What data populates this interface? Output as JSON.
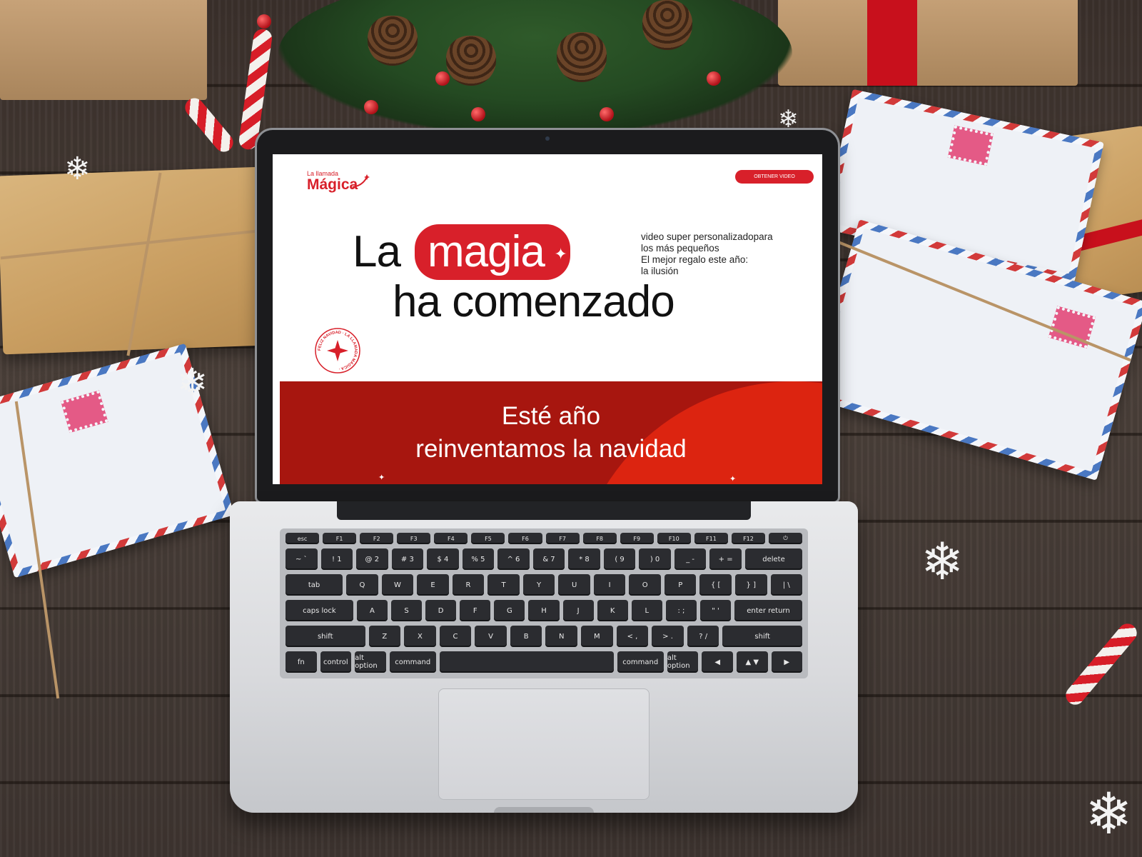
{
  "site": {
    "logo": {
      "small": "La llamada",
      "big": "Mágica"
    },
    "cta_label": "OBTENER VIDEO",
    "hero": {
      "word_1": "La",
      "highlight": "magia",
      "line_2": "ha comenzado",
      "side_lines": [
        "video super personalizadopara",
        "los más pequeños",
        "El mejor regalo este año:",
        "la ilusión"
      ],
      "badge_text": "FELIZ NAVIDAD · LA LLAMADA MÁGICA ·"
    },
    "band": {
      "line_1": "Esté año",
      "line_2": "reinventamos la navidad"
    }
  },
  "keyboard": {
    "fn_row": [
      "esc",
      "F1",
      "F2",
      "F3",
      "F4",
      "F5",
      "F6",
      "F7",
      "F8",
      "F9",
      "F10",
      "F11",
      "F12",
      "⏻"
    ],
    "row_1": [
      "~ `",
      "! 1",
      "@ 2",
      "# 3",
      "$ 4",
      "% 5",
      "^ 6",
      "& 7",
      "* 8",
      "( 9",
      ") 0",
      "_ -",
      "+ =",
      "delete"
    ],
    "row_2": [
      "tab",
      "Q",
      "W",
      "E",
      "R",
      "T",
      "Y",
      "U",
      "I",
      "O",
      "P",
      "{ [",
      "} ]",
      "| \\"
    ],
    "row_3": [
      "caps lock",
      "A",
      "S",
      "D",
      "F",
      "G",
      "H",
      "J",
      "K",
      "L",
      ": ;",
      "\" '",
      "enter return"
    ],
    "row_4": [
      "shift",
      "Z",
      "X",
      "C",
      "V",
      "B",
      "N",
      "M",
      "< ,",
      "> .",
      "? /",
      "shift"
    ],
    "row_5": [
      "fn",
      "control",
      "alt option",
      "command",
      "",
      "command",
      "alt option",
      "◀",
      "▲ ▼",
      "▶"
    ]
  },
  "colors": {
    "brand_red": "#d8202a",
    "band_dark_red": "#a7160f",
    "band_bright_red": "#dc2410"
  }
}
